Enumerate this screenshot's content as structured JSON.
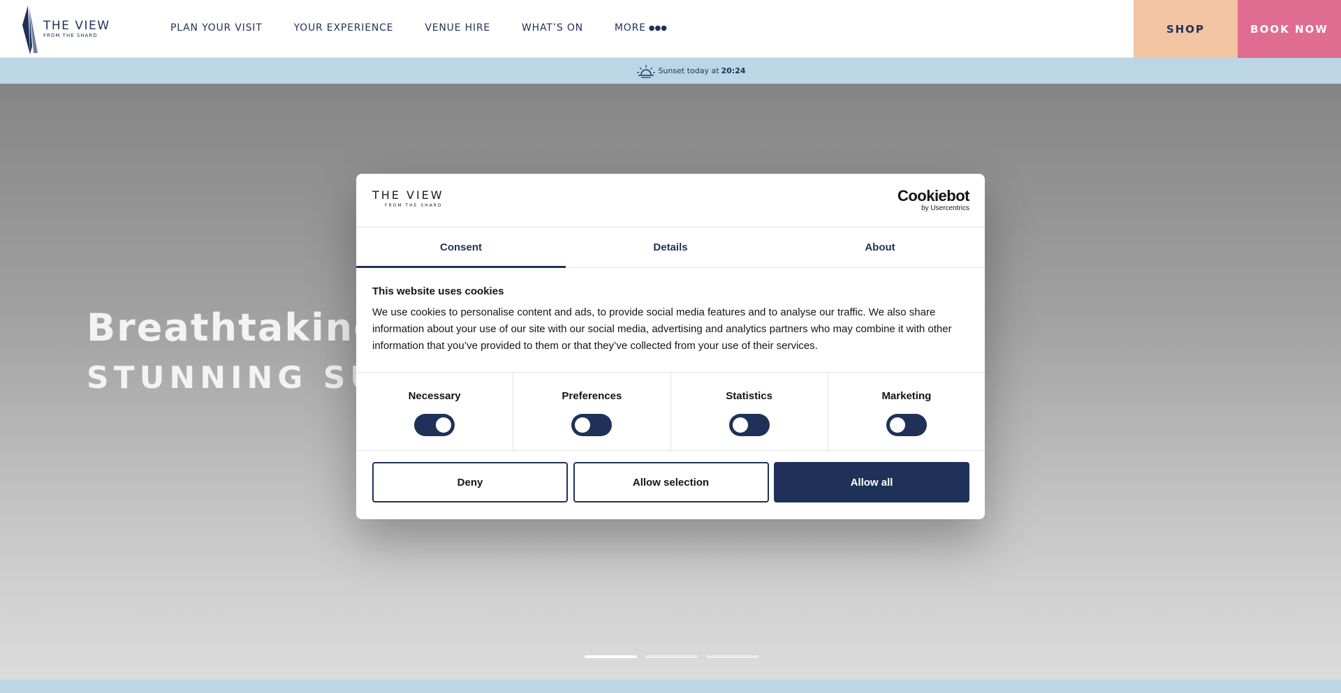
{
  "header": {
    "logo": {
      "title": "THE VIEW",
      "subtitle": "FROM THE SHARD",
      "icon": "shard-logo-icon"
    },
    "nav": [
      {
        "label": "PLAN YOUR VISIT"
      },
      {
        "label": "YOUR EXPERIENCE"
      },
      {
        "label": "VENUE HIRE"
      },
      {
        "label": "WHAT’S ON"
      },
      {
        "label": "MORE",
        "icon": "more-dots-icon",
        "dots": "●●●"
      }
    ],
    "shop_label": "SHOP",
    "book_label": "BOOK NOW"
  },
  "sunset": {
    "icon": "sunset-icon",
    "text": "Sunset today at",
    "time": "20:24"
  },
  "hero": {
    "title": "Breathtaking V",
    "subtitle": "STUNNING SU",
    "slides": {
      "count": 3,
      "active": 1
    }
  },
  "cookie_dialog": {
    "logo": {
      "title": "THE VIEW",
      "subtitle": "FROM THE SHARD"
    },
    "brand": {
      "name": "Cookiebot",
      "by": "by Usercentrics"
    },
    "tabs": [
      {
        "label": "Consent",
        "active": true
      },
      {
        "label": "Details",
        "active": false
      },
      {
        "label": "About",
        "active": false
      }
    ],
    "heading": "This website uses cookies",
    "body": "We use cookies to personalise content and ads, to provide social media features and to analyse our traffic. We also share information about your use of our site with our social media, advertising and analytics partners who may combine it with other information that you’ve provided to them or that they’ve collected from your use of their services.",
    "toggles": [
      {
        "label": "Necessary",
        "on": true
      },
      {
        "label": "Preferences",
        "on": false
      },
      {
        "label": "Statistics",
        "on": false
      },
      {
        "label": "Marketing",
        "on": false
      }
    ],
    "buttons": {
      "deny": "Deny",
      "allow_selection": "Allow selection",
      "allow_all": "Allow all"
    }
  },
  "colors": {
    "navy": "#1f3158",
    "shop_bg": "#f2c4a2",
    "book_bg": "#e06c92",
    "sunset_bar_bg": "#bcd6e6"
  }
}
